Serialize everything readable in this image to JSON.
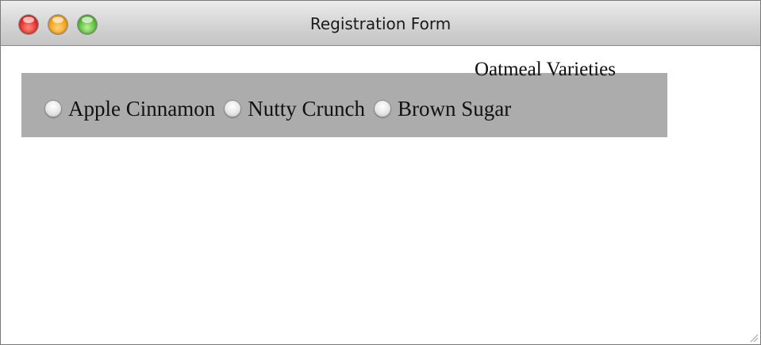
{
  "window": {
    "title": "Registration Form"
  },
  "form": {
    "legend": "Oatmeal Varieties",
    "options": [
      {
        "label": "Apple Cinnamon",
        "checked": false
      },
      {
        "label": "Nutty Crunch",
        "checked": false
      },
      {
        "label": "Brown Sugar",
        "checked": false
      }
    ]
  }
}
